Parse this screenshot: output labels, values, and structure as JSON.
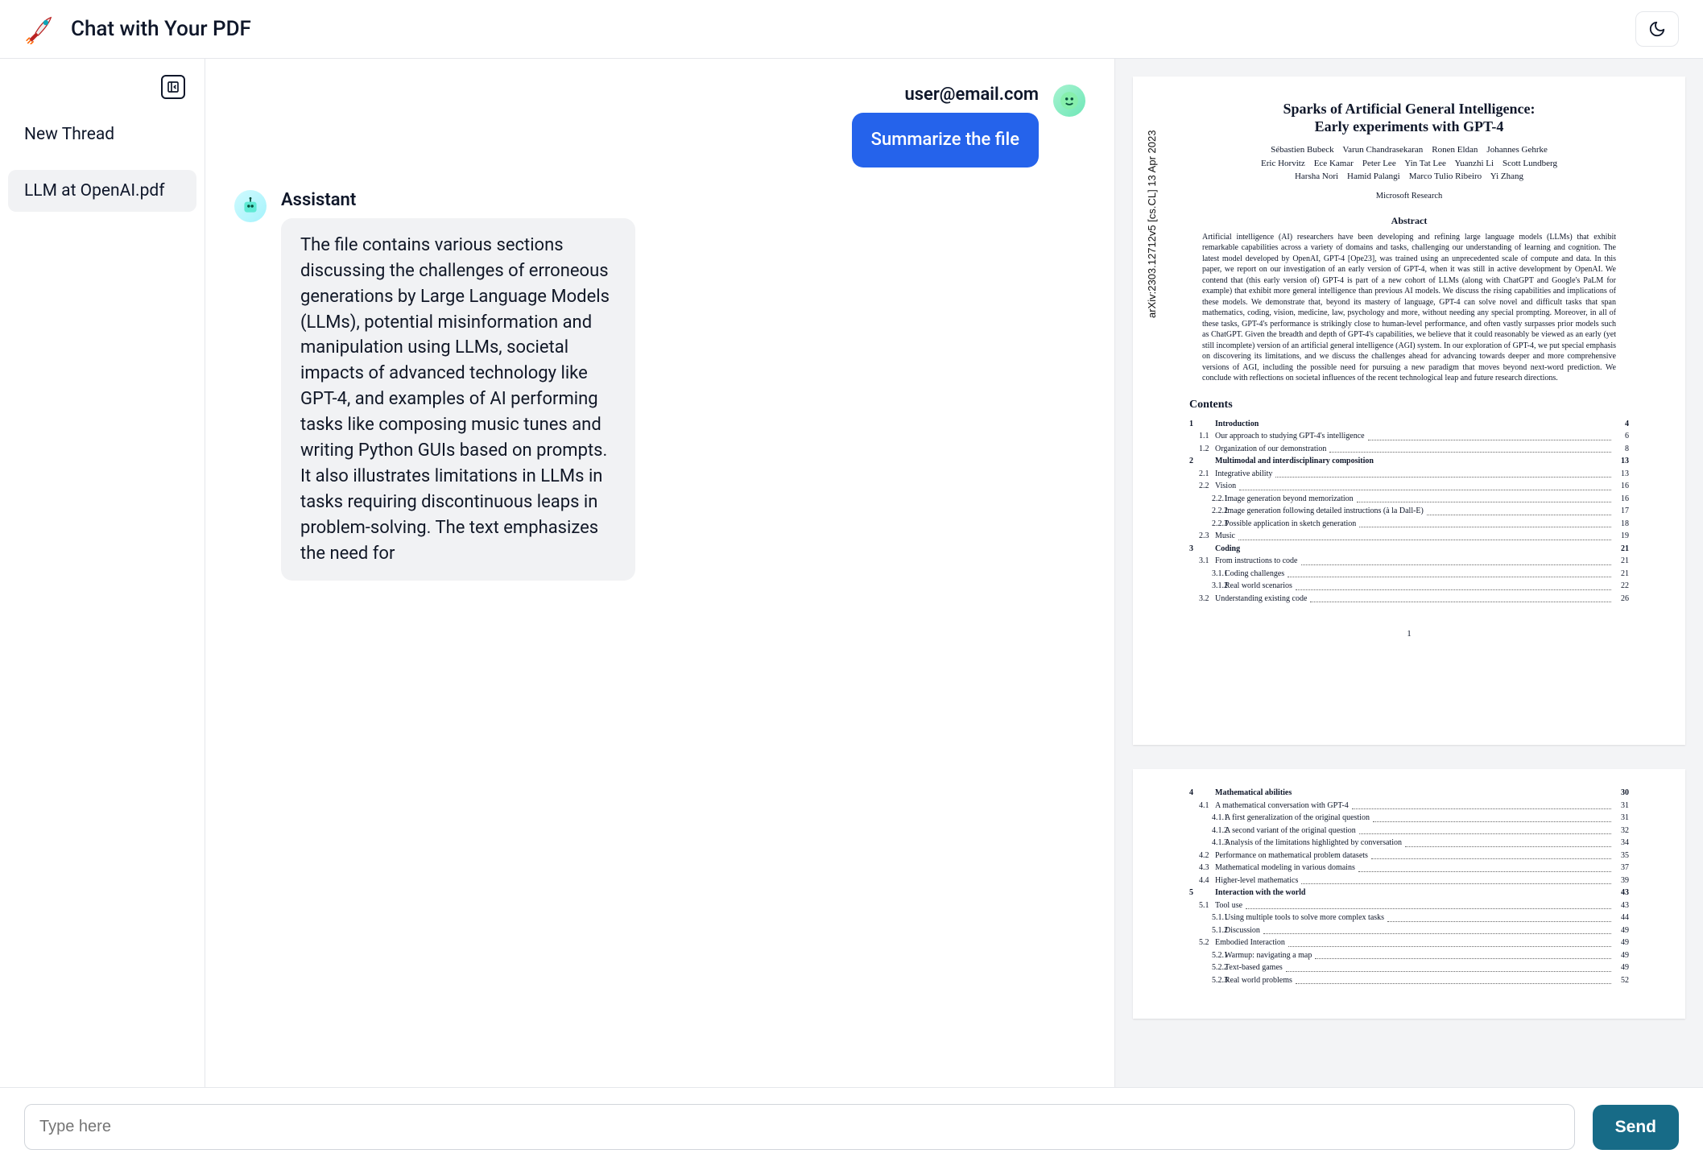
{
  "header": {
    "title": "Chat with Your PDF"
  },
  "sidebar": {
    "new_thread": "New Thread",
    "items": [
      {
        "label": "LLM at OpenAI.pdf"
      }
    ]
  },
  "chat": {
    "user_name": "user@email.com",
    "user_message": "Summarize the file",
    "assistant_name": "Assistant",
    "assistant_message": "The file contains various sections discussing the challenges of erroneous generations by Large Language Models (LLMs), potential misinformation and manipulation using LLMs, societal impacts of advanced technology like GPT-4, and examples of AI performing tasks like composing music tunes and writing Python GUIs based on prompts. It also illustrates limitations in LLMs in tasks requiring discontinuous leaps in problem-solving. The text emphasizes the need for"
  },
  "composer": {
    "placeholder": "Type here",
    "send": "Send"
  },
  "pdf": {
    "arxiv": "arXiv:2303.12712v5 [cs.CL] 13 Apr 2023",
    "title_line1": "Sparks of Artificial General Intelligence:",
    "title_line2": "Early experiments with GPT-4",
    "authors_line1": "Sébastien Bubeck    Varun Chandrasekaran    Ronen Eldan    Johannes Gehrke",
    "authors_line2": "Eric Horvitz    Ece Kamar    Peter Lee    Yin Tat Lee    Yuanzhi Li    Scott Lundberg",
    "authors_line3": "Harsha Nori    Hamid Palangi    Marco Tulio Ribeiro    Yi Zhang",
    "org": "Microsoft Research",
    "abstract_h": "Abstract",
    "abstract": "Artificial intelligence (AI) researchers have been developing and refining large language models (LLMs) that exhibit remarkable capabilities across a variety of domains and tasks, challenging our understanding of learning and cognition. The latest model developed by OpenAI, GPT-4 [Ope23], was trained using an unprecedented scale of compute and data. In this paper, we report on our investigation of an early version of GPT-4, when it was still in active development by OpenAI. We contend that (this early version of) GPT-4 is part of a new cohort of LLMs (along with ChatGPT and Google's PaLM for example) that exhibit more general intelligence than previous AI models. We discuss the rising capabilities and implications of these models. We demonstrate that, beyond its mastery of language, GPT-4 can solve novel and difficult tasks that span mathematics, coding, vision, medicine, law, psychology and more, without needing any special prompting. Moreover, in all of these tasks, GPT-4's performance is strikingly close to human-level performance, and often vastly surpasses prior models such as ChatGPT. Given the breadth and depth of GPT-4's capabilities, we believe that it could reasonably be viewed as an early (yet still incomplete) version of an artificial general intelligence (AGI) system. In our exploration of GPT-4, we put special emphasis on discovering its limitations, and we discuss the challenges ahead for advancing towards deeper and more comprehensive versions of AGI, including the possible need for pursuing a new paradigm that moves beyond next-word prediction. We conclude with reflections on societal influences of the recent technological leap and future research directions.",
    "contents_h": "Contents",
    "page1_num": "1",
    "toc1": [
      {
        "n": "1",
        "l": "Introduction",
        "p": "4",
        "b": true,
        "i": 0
      },
      {
        "n": "1.1",
        "l": "Our approach to studying GPT-4's intelligence",
        "p": "6",
        "i": 1
      },
      {
        "n": "1.2",
        "l": "Organization of our demonstration",
        "p": "8",
        "i": 1
      },
      {
        "n": "2",
        "l": "Multimodal and interdisciplinary composition",
        "p": "13",
        "b": true,
        "i": 0
      },
      {
        "n": "2.1",
        "l": "Integrative ability",
        "p": "13",
        "i": 1
      },
      {
        "n": "2.2",
        "l": "Vision",
        "p": "16",
        "i": 1
      },
      {
        "n": "2.2.1",
        "l": "Image generation beyond memorization",
        "p": "16",
        "i": 2
      },
      {
        "n": "2.2.2",
        "l": "Image generation following detailed instructions (à la Dall-E)",
        "p": "17",
        "i": 2
      },
      {
        "n": "2.2.3",
        "l": "Possible application in sketch generation",
        "p": "18",
        "i": 2
      },
      {
        "n": "2.3",
        "l": "Music",
        "p": "19",
        "i": 1
      },
      {
        "n": "3",
        "l": "Coding",
        "p": "21",
        "b": true,
        "i": 0
      },
      {
        "n": "3.1",
        "l": "From instructions to code",
        "p": "21",
        "i": 1
      },
      {
        "n": "3.1.1",
        "l": "Coding challenges",
        "p": "21",
        "i": 2
      },
      {
        "n": "3.1.2",
        "l": "Real world scenarios",
        "p": "22",
        "i": 2
      },
      {
        "n": "3.2",
        "l": "Understanding existing code",
        "p": "26",
        "i": 1
      }
    ],
    "toc2": [
      {
        "n": "4",
        "l": "Mathematical abilities",
        "p": "30",
        "b": true,
        "i": 0
      },
      {
        "n": "4.1",
        "l": "A mathematical conversation with GPT-4",
        "p": "31",
        "i": 1
      },
      {
        "n": "4.1.1",
        "l": "A first generalization of the original question",
        "p": "31",
        "i": 2
      },
      {
        "n": "4.1.2",
        "l": "A second variant of the original question",
        "p": "32",
        "i": 2
      },
      {
        "n": "4.1.3",
        "l": "Analysis of the limitations highlighted by conversation",
        "p": "34",
        "i": 2
      },
      {
        "n": "4.2",
        "l": "Performance on mathematical problem datasets",
        "p": "35",
        "i": 1
      },
      {
        "n": "4.3",
        "l": "Mathematical modeling in various domains",
        "p": "37",
        "i": 1
      },
      {
        "n": "4.4",
        "l": "Higher-level mathematics",
        "p": "39",
        "i": 1
      },
      {
        "n": "5",
        "l": "Interaction with the world",
        "p": "43",
        "b": true,
        "i": 0
      },
      {
        "n": "5.1",
        "l": "Tool use",
        "p": "43",
        "i": 1
      },
      {
        "n": "5.1.1",
        "l": "Using multiple tools to solve more complex tasks",
        "p": "44",
        "i": 2
      },
      {
        "n": "5.1.2",
        "l": "Discussion",
        "p": "49",
        "i": 2
      },
      {
        "n": "5.2",
        "l": "Embodied Interaction",
        "p": "49",
        "i": 1
      },
      {
        "n": "5.2.1",
        "l": "Warmup: navigating a map",
        "p": "49",
        "i": 2
      },
      {
        "n": "5.2.2",
        "l": "Text-based games",
        "p": "49",
        "i": 2
      },
      {
        "n": "5.2.3",
        "l": "Real world problems",
        "p": "52",
        "i": 2
      }
    ]
  }
}
